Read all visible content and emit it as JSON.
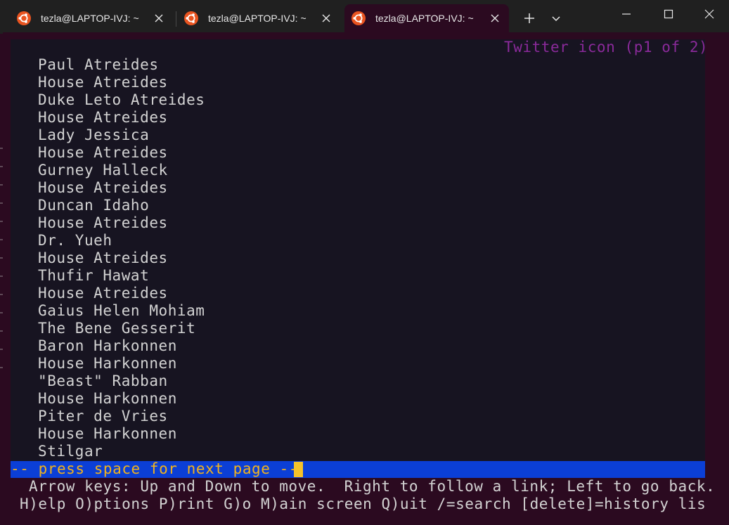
{
  "tabs": [
    {
      "label": "tezla@LAPTOP-IVJ: ~",
      "active": false
    },
    {
      "label": "tezla@LAPTOP-IVJ: ~",
      "active": false
    },
    {
      "label": "tezla@LAPTOP-IVJ: ~",
      "active": true
    }
  ],
  "titlebar": {
    "new_tab": "+",
    "dropdown": "⌄"
  },
  "terminal": {
    "header": "Twitter icon (p1 of 2)",
    "lines": [
      "Paul Atreides",
      "House Atreides",
      "Duke Leto Atreides",
      "House Atreides",
      "Lady Jessica",
      "House Atreides",
      "Gurney Halleck",
      "House Atreides",
      "Duncan Idaho",
      "House Atreides",
      "Dr. Yueh",
      "House Atreides",
      "Thufir Hawat",
      "House Atreides",
      "Gaius Helen Mohiam",
      "The Bene Gesserit",
      "Baron Harkonnen",
      "House Harkonnen",
      "\"Beast\" Rabban",
      "House Harkonnen",
      "Piter de Vries",
      "House Harkonnen",
      "Stilgar"
    ],
    "status": "-- press space for next page --",
    "help1": "Arrow keys: Up and Down to move.  Right to follow a link; Left to go back.",
    "help2": "H)elp O)ptions P)rint G)o M)ain screen Q)uit /=search [delete]=history lis"
  },
  "colors": {
    "terminal_bg": "#171421",
    "frame_bg": "#2b0a20",
    "header_text": "#8a2a9a",
    "status_bar": "#0b3fd6",
    "status_text": "#f2b31c"
  }
}
